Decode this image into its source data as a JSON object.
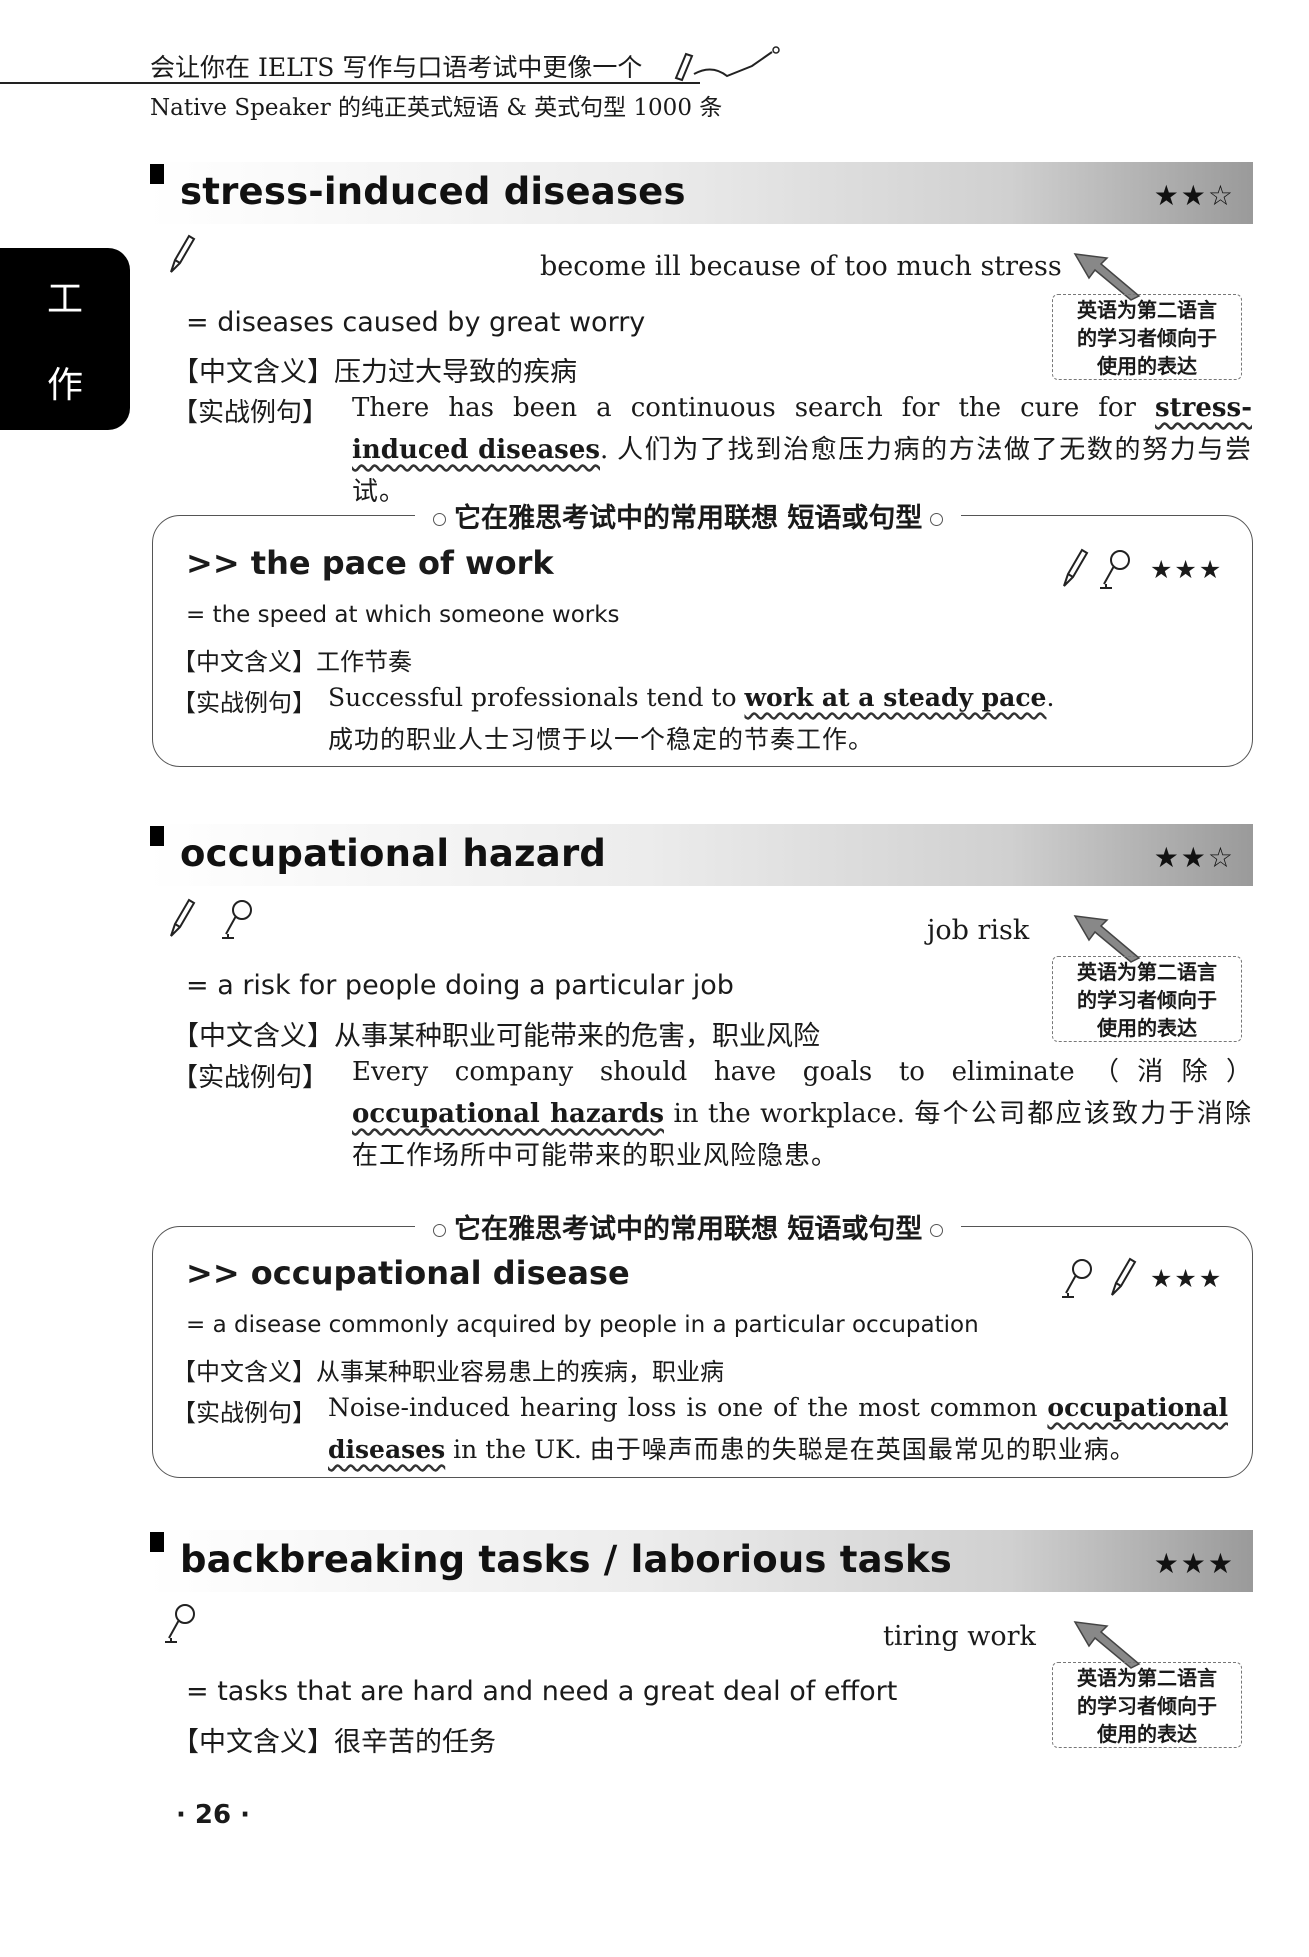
{
  "header": {
    "line1": "会让你在 IELTS 写作与口语考试中更像一个",
    "line2": "Native Speaker 的纯正英式短语 & 英式句型 1000 条"
  },
  "side_tab": {
    "char1": "工",
    "char2": "作"
  },
  "note_box_text": [
    "英语为第二语言",
    "的学习者倾向于",
    "使用的表达"
  ],
  "entries": [
    {
      "title": "stress-induced diseases",
      "stars": "★★☆",
      "gloss": "become ill because of too much stress",
      "definition": "= diseases caused by great worry",
      "cn_label": "【中文含义】",
      "cn_meaning": "压力过大导致的疾病",
      "ex_label": "【实战例句】",
      "example_pre": "There has been a continuous search for the cure for ",
      "example_hl": "stress-induced diseases",
      "example_post": ". ",
      "example_cn": "人们为了找到治愈压力病的方法做了无数的努力与尝试。"
    },
    {
      "title": "occupational hazard",
      "stars": "★★☆",
      "gloss": "job risk",
      "definition": "= a risk for people doing a particular job",
      "cn_label": "【中文含义】",
      "cn_meaning": "从事某种职业可能带来的危害，职业风险",
      "ex_label": "【实战例句】",
      "example_pre": "Every company should have goals to eliminate（消除）",
      "example_hl": "occupational hazards",
      "example_post": " in the workplace. ",
      "example_cn": "每个公司都应该致力于消除在工作场所中可能带来的职业风险隐患。"
    },
    {
      "title": "backbreaking tasks / laborious tasks",
      "stars": "★★★",
      "gloss": "tiring work",
      "definition": "= tasks that are hard and need a great deal of effort",
      "cn_label": "【中文含义】",
      "cn_meaning": "很辛苦的任务"
    }
  ],
  "assoc_heading": "它在雅思考试中的常用联想 短语或句型",
  "assoc": [
    {
      "title": ">> the pace of work",
      "stars": "★★★",
      "definition": "= the speed at which someone works",
      "cn_label": "【中文含义】",
      "cn_meaning": "工作节奏",
      "ex_label": "【实战例句】",
      "example_pre": "Successful professionals tend to ",
      "example_hl": "work at a steady pace",
      "example_post": ".",
      "example_cn": "成功的职业人士习惯于以一个稳定的节奏工作。"
    },
    {
      "title": ">> occupational disease",
      "stars": "★★★",
      "definition": "= a disease commonly acquired by people in a particular occupation",
      "cn_label": "【中文含义】",
      "cn_meaning": "从事某种职业容易患上的疾病，职业病",
      "ex_label": "【实战例句】",
      "example_pre": "Noise-induced hearing loss is one of the most common ",
      "example_hl": "occupational diseases",
      "example_post": " in the UK. ",
      "example_cn": "由于噪声而患的失聪是在英国最常见的职业病。"
    }
  ],
  "page_number": "· 26 ·"
}
